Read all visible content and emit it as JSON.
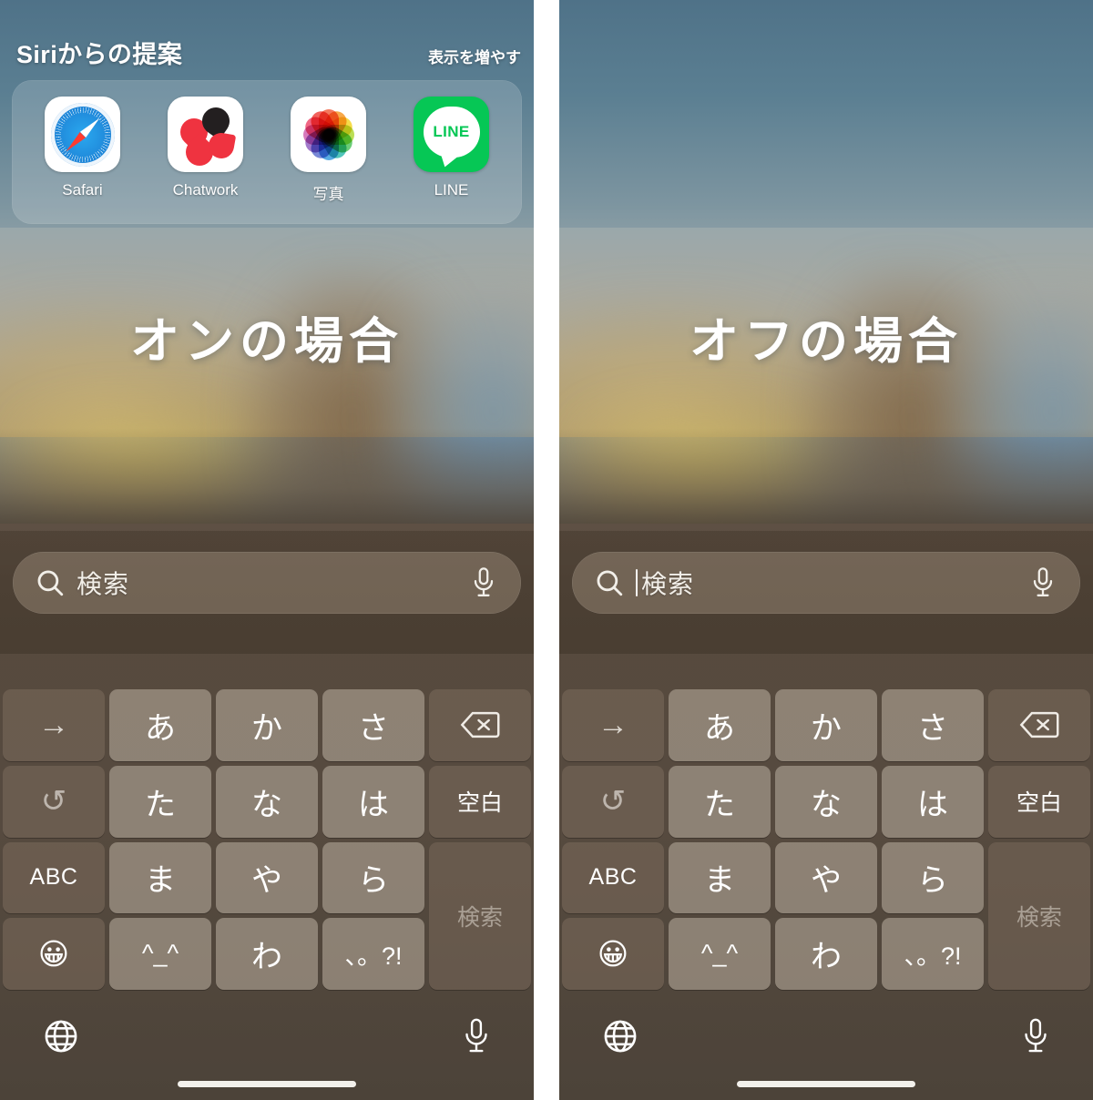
{
  "panels": [
    {
      "id": "left",
      "caption": "オンの場合",
      "siri_visible": true,
      "siri": {
        "title": "Siriからの提案",
        "more_label": "表示を増やす",
        "apps": [
          {
            "label": "Safari",
            "icon": "safari-icon"
          },
          {
            "label": "Chatwork",
            "icon": "chatwork-icon"
          },
          {
            "label": "写真",
            "icon": "photos-icon"
          },
          {
            "label": "LINE",
            "icon": "line-icon",
            "glyph_text": "LINE"
          }
        ]
      },
      "search": {
        "placeholder": "検索",
        "caret_visible": false,
        "search_icon": "search-icon",
        "mic_icon": "microphone-icon"
      }
    },
    {
      "id": "right",
      "caption": "オフの場合",
      "siri_visible": false,
      "search": {
        "placeholder": "検索",
        "caret_visible": true,
        "search_icon": "search-icon",
        "mic_icon": "microphone-icon"
      }
    }
  ],
  "keyboard": {
    "keys": [
      {
        "label": "→",
        "name": "key-arrow-right",
        "type": "fn",
        "style": "arrow"
      },
      {
        "label": "あ",
        "name": "key-a",
        "type": "char",
        "style": ""
      },
      {
        "label": "か",
        "name": "key-ka",
        "type": "char",
        "style": ""
      },
      {
        "label": "さ",
        "name": "key-sa",
        "type": "char",
        "style": ""
      },
      {
        "label": "",
        "name": "key-delete",
        "type": "fn",
        "style": "icon-delete"
      },
      {
        "label": "↺",
        "name": "key-undo",
        "type": "fn",
        "style": "undo"
      },
      {
        "label": "た",
        "name": "key-ta",
        "type": "char",
        "style": ""
      },
      {
        "label": "な",
        "name": "key-na",
        "type": "char",
        "style": ""
      },
      {
        "label": "は",
        "name": "key-ha",
        "type": "char",
        "style": ""
      },
      {
        "label": "空白",
        "name": "key-space",
        "type": "fn",
        "style": "small"
      },
      {
        "label": "ABC",
        "name": "key-abc",
        "type": "fn",
        "style": "abc"
      },
      {
        "label": "ま",
        "name": "key-ma",
        "type": "char",
        "style": ""
      },
      {
        "label": "や",
        "name": "key-ya",
        "type": "char",
        "style": ""
      },
      {
        "label": "ら",
        "name": "key-ra",
        "type": "char",
        "style": ""
      },
      {
        "label": "検索",
        "name": "key-search-enter",
        "type": "tall",
        "style": ""
      },
      {
        "label": "😀",
        "name": "key-emoji",
        "type": "fn",
        "style": "emoji"
      },
      {
        "label": "^_^",
        "name": "key-kaomoji",
        "type": "char",
        "style": "sym"
      },
      {
        "label": "わ",
        "name": "key-wa",
        "type": "char",
        "style": ""
      },
      {
        "label": "、。?!",
        "name": "key-punctuation",
        "type": "char",
        "style": "sym"
      }
    ],
    "bottom_bar": {
      "globe_icon": "globe-icon",
      "mic_icon": "microphone-icon"
    }
  },
  "colors": {
    "line_green": "#06c755",
    "chatwork_red": "#ef3340",
    "chatwork_dark": "#231f20",
    "safari_blue": "#1f86d8",
    "needle_red": "#ff3b30",
    "key_char": "rgba(176,164,150,.62)",
    "key_fn": "rgba(120,104,89,.62)"
  },
  "photos_petal_colors": [
    "#f26d4f",
    "#f7a23b",
    "#f6d93b",
    "#b7dc46",
    "#5ec96b",
    "#43c0b5",
    "#4aa3e0",
    "#6d7fd4",
    "#9a6fc7",
    "#d36fb6",
    "#ef5a7a",
    "#f0544f"
  ]
}
